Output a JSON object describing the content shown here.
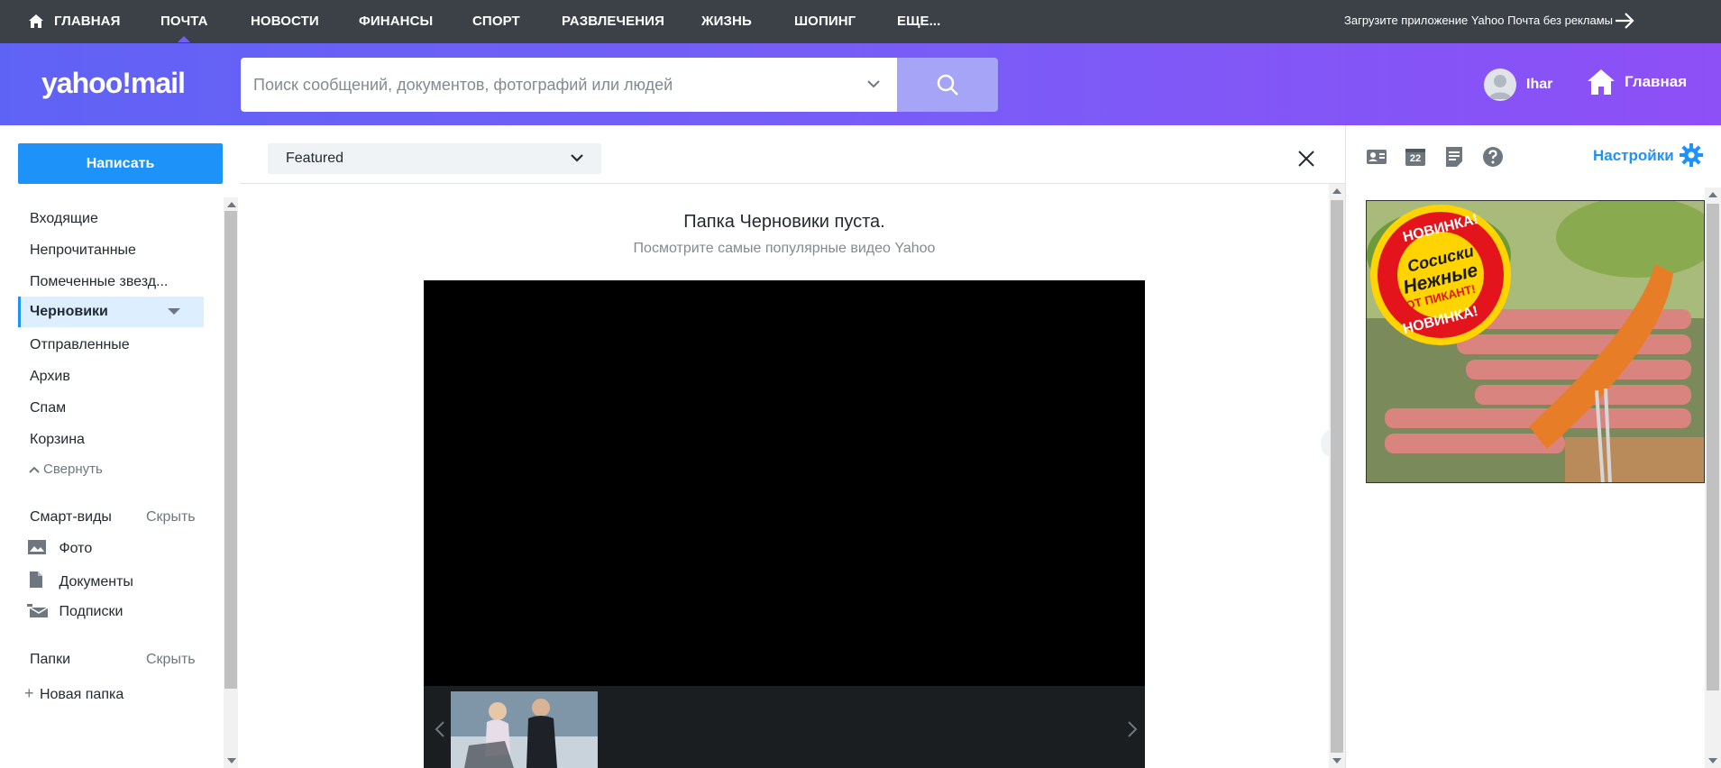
{
  "topnav": {
    "items": [
      {
        "label": "ГЛАВНАЯ",
        "icon": "home-icon"
      },
      {
        "label": "ПОЧТА",
        "active": true
      },
      {
        "label": "НОВОСТИ"
      },
      {
        "label": "ФИНАНСЫ"
      },
      {
        "label": "СПОРТ"
      },
      {
        "label": "РАЗВЛЕЧЕНИЯ"
      },
      {
        "label": "ЖИЗНЬ"
      },
      {
        "label": "ШОПИНГ"
      },
      {
        "label": "ЕЩЕ..."
      }
    ],
    "app_promo": "Загрузите приложение Yahoo Почта без рекламы"
  },
  "header": {
    "logo": "yahoo!mail",
    "search_placeholder": "Поиск сообщений, документов, фотографий или людей",
    "user_name": "Ihar",
    "home_label": "Главная"
  },
  "sidebar": {
    "compose_label": "Написать",
    "folders": [
      {
        "label": "Входящие"
      },
      {
        "label": "Непрочитанные"
      },
      {
        "label": "Помеченные звезд..."
      },
      {
        "label": "Черновики",
        "selected": true
      },
      {
        "label": "Отправленные"
      },
      {
        "label": "Архив"
      },
      {
        "label": "Спам"
      },
      {
        "label": "Корзина"
      }
    ],
    "collapse_label": "Свернуть",
    "smart_views_label": "Смарт-виды",
    "smart_views_hide": "Скрыть",
    "smart_views": [
      {
        "label": "Фото",
        "icon": "photo-icon"
      },
      {
        "label": "Документы",
        "icon": "document-icon"
      },
      {
        "label": "Подписки",
        "icon": "subscriptions-icon"
      }
    ],
    "folders_label": "Папки",
    "folders_hide": "Скрыть",
    "new_folder_label": "Новая папка"
  },
  "center": {
    "filter_value": "Featured",
    "empty_title": "Папка Черновики пуста.",
    "empty_subtitle": "Посмотрите самые популярные видео Yahoo"
  },
  "right": {
    "icons": [
      "contacts-icon",
      "calendar-icon",
      "notepad-icon",
      "help-icon"
    ],
    "calendar_day": "22",
    "settings_label": "Настройки",
    "ad": {
      "badge_top": "НОВИНКА!",
      "badge_line1": "Сосиски",
      "badge_line2": "Нежные",
      "badge_line3": "ОТ ПИКАНТ!",
      "badge_bottom": "НОВИНКА!"
    }
  },
  "colors": {
    "accent": "#1d93fa",
    "topnav_bg": "#3c4148",
    "header_gradient_start": "#5f63f5",
    "header_gradient_end": "#8d4ff6",
    "selected_folder_bg": "#dceeff"
  }
}
